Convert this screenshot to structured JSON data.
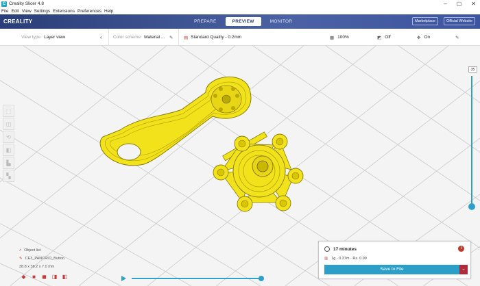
{
  "window": {
    "title": "Creality Slicer 4.8",
    "app_icon": "C",
    "minimize": "–",
    "maximize": "▢",
    "close": "✕"
  },
  "menu": [
    "File",
    "Edit",
    "View",
    "Settings",
    "Extensions",
    "Preferences",
    "Help"
  ],
  "header": {
    "logo": "CREALITY",
    "stages": [
      "PREPARE",
      "PREVIEW",
      "MONITOR"
    ],
    "active_stage": "PREVIEW",
    "marketplace": "Marketplace",
    "official_website": "Official Website"
  },
  "toolbar": {
    "view_type_label": "View type",
    "view_type_value": "Layer view",
    "color_scheme_label": "Color scheme",
    "color_scheme_value": "Material ...",
    "profile": "Standard Quality - 0.2mm",
    "infill": "100%",
    "support": "Off",
    "adhesion": "On"
  },
  "layer_slider": {
    "current_layer": "35"
  },
  "object_list": {
    "title": "Object list",
    "object_name": "CE3_PANCRIO_Button",
    "dimensions": "38.8 x 38.2 x 7.0 mm"
  },
  "print_info": {
    "time": "17 minutes",
    "material": "1g · 0.37m · Rs. 0.99",
    "save_button": "Save to File",
    "dropdown": "⌄"
  },
  "colors": {
    "accent": "#2ea0cc",
    "model": "#f2e21c",
    "brand": "#2a3e79",
    "danger": "#b22b3a"
  }
}
